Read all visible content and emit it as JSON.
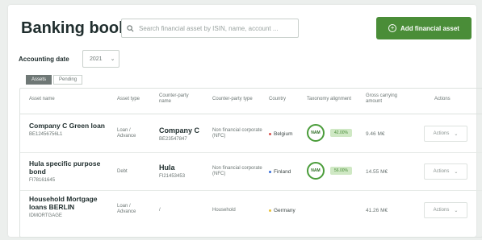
{
  "page": {
    "title": "Banking book",
    "search_placeholder": "Search financial asset by ISIN, name, account ...",
    "add_button_label": "Add financial asset",
    "add_button_icon": "plus-circle-icon"
  },
  "filters": {
    "accounting_date_label": "Accounting date",
    "accounting_date_value": "2021"
  },
  "tabs": [
    {
      "label": "Assets",
      "active": true
    },
    {
      "label": "Pending",
      "active": false
    }
  ],
  "table": {
    "headers": {
      "asset_name": "Asset name",
      "asset_type": "Asset type",
      "counterparty_name": "Counter-party name",
      "counterparty_type": "Counter-party type",
      "country": "Country",
      "taxonomy": "Taxonomy alignment",
      "amount": "Gross carrying amount",
      "actions": "Actions"
    },
    "rows": [
      {
        "name": "Company C Green loan",
        "id": "BE12456756L1",
        "type": "Loan / Advance",
        "cp_name": "Company C",
        "cp_id": "BE23547847",
        "cp_type": "Non financial corporate (NFC)",
        "country": "Belgium",
        "country_color": "#d9534f",
        "ring": "NAM",
        "pill": "42.00%",
        "amount": "9.46 M€",
        "actions": "Actions"
      },
      {
        "name": "Hula specific purpose bond",
        "id": "FI78161645",
        "type": "Debt",
        "cp_name": "Hula",
        "cp_id": "FI21453453",
        "cp_type": "Non financial corporate (NFC)",
        "country": "Finland",
        "country_color": "#3a6fd8",
        "ring": "NAM",
        "pill": "56.00%",
        "amount": "14.55 M€",
        "actions": "Actions"
      },
      {
        "name": "Household Mortgage loans BERLIN",
        "id": "IDMORTGAGE",
        "type": "Loan / Advance",
        "cp_name": "",
        "cp_id": "/",
        "cp_type": "Household",
        "country": "Germany",
        "country_color": "#e8c03a",
        "ring": "",
        "pill": "",
        "amount": "41.26 M€",
        "actions": "Actions"
      }
    ]
  }
}
